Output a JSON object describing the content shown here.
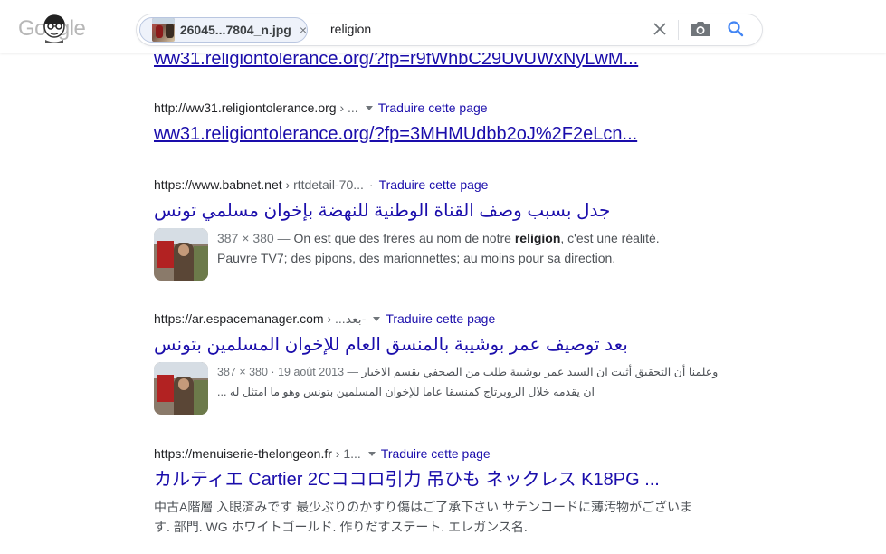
{
  "header": {
    "logo_text": "Google",
    "chip_name": "26045...7804_n.jpg",
    "chip_remove": "×",
    "query": "religion"
  },
  "results": {
    "cut_title": "ww31.religiontolerance.org/?fp=r9fWhbC29UvUWxNyLwM...",
    "items": [
      {
        "domain": "http://ww31.religiontolerance.org",
        "crumb": "› ...",
        "translate": "Traduire cette page",
        "title": "ww31.religiontolerance.org/?fp=3MHMUdbb2oJ%2F2eLcn..."
      },
      {
        "domain": "https://www.babnet.net",
        "crumb": "› rttdetail-70...",
        "separator": "·",
        "translate": "Traduire cette page",
        "title": "جدل بسبب وصف القناة الوطنية للنهضة بإخوان مسلمي تونس",
        "meta": "387 × 380 —",
        "snippet_pre": " On est que des frères au nom de notre ",
        "snippet_bold": "religion",
        "snippet_post": ", c'est une réalité. Pauvre TV7; des pipons, des marionnettes; au moins pour sa direction."
      },
      {
        "domain": "https://ar.espacemanager.com",
        "crumb": "› ...بعد-",
        "translate": "Traduire cette page",
        "title": "بعد توصيف عمر بوشيبة بالمنسق العام للإخوان المسلمين بتونس",
        "meta": "387 × 380 · 19 août 2013 —",
        "snippet_line1": "وعلمنا أن التحقيق أثبت ان السيد عمر بوشيبة طلب من الصحفي بقسم الاخبار",
        "snippet_line2": "ان يقدمه خلال الروبرتاج كمنسقا عاما للإخوان المسلمين بتونس وهو ما امتثل له ..."
      },
      {
        "domain": "https://menuiserie-thelongeon.fr",
        "crumb": "› 1...",
        "translate": "Traduire cette page",
        "title": "カルティエ Cartier 2Cココロ引力 吊ひも ネックレス K18PG ...",
        "snippet_line1": "中古A階層 入眼済みです 最少ぶりのかすり傷はご了承下さい サテンコードに薄汚物がございま",
        "snippet_line2": "す. 部門. WG ホワイトゴールド. 作りだすステート. エレガンス名."
      }
    ]
  }
}
